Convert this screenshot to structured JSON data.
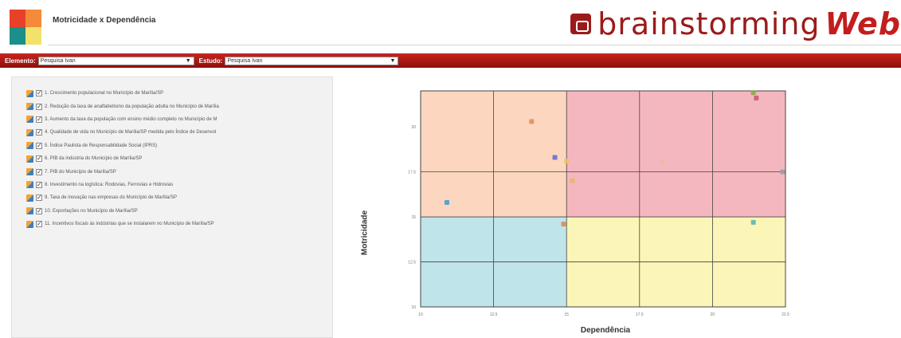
{
  "header": {
    "title": "Motricidade x Dependência",
    "brand_main": "brainstorming",
    "brand_accent": "Web"
  },
  "toolbar": {
    "element_label": "Elemento:",
    "element_value": "Pesquisa Ivan",
    "study_label": "Estudo:",
    "study_value": "Pesquisa Ivan"
  },
  "variables": [
    {
      "label": "1. Crescimento populacional no Município de Marília/SP",
      "checked": true
    },
    {
      "label": "2. Redução da taxa de analfabetismo da população adulta no Município de Marília",
      "checked": true
    },
    {
      "label": "3. Aumento da taxa da população com ensino médio completo no Município de M",
      "checked": true
    },
    {
      "label": "4. Qualidade de vida no Município de Marília/SP medida pelo Índice de Desenvol",
      "checked": true
    },
    {
      "label": "5. Índice Paulista de Responsabilidade Social (IPRS)",
      "checked": true
    },
    {
      "label": "6. PIB da indústria do Município de Marília/SP",
      "checked": true
    },
    {
      "label": "7. PIB do Município de Marília/SP",
      "checked": true
    },
    {
      "label": "8. Investimento na logística: Rodovias, Ferrovias e Hidrovias",
      "checked": true
    },
    {
      "label": "9. Taxa de inovação nas empresas do Município de Marília/SP",
      "checked": true
    },
    {
      "label": "10. Exportações no Município de Marília/SP",
      "checked": true
    },
    {
      "label": "11. Incentivos fiscais às indústrias que se instalarem no Município de Marília/SP",
      "checked": true
    }
  ],
  "chart_data": {
    "type": "scatter",
    "xlabel": "Dependência",
    "ylabel": "Motricidade",
    "xlim": [
      10,
      22.5
    ],
    "ylim": [
      10,
      22
    ],
    "x_ticks": [
      "10",
      "12.5",
      "15",
      "17.5",
      "20",
      "22.5"
    ],
    "y_ticks": [
      "10",
      "12.5",
      "15",
      "17.5",
      "20"
    ],
    "quadrant_colors": {
      "top_left": "#fcd6bf",
      "top_right": "#f5b7bf",
      "bottom_left": "#bfe4ea",
      "bottom_right": "#fbf5b8"
    },
    "points": [
      {
        "x": 10.9,
        "y": 15.8,
        "color": "#4a9bd1"
      },
      {
        "x": 13.8,
        "y": 20.3,
        "color": "#e0915a"
      },
      {
        "x": 14.6,
        "y": 18.3,
        "color": "#6a6fd0"
      },
      {
        "x": 15.0,
        "y": 18.1,
        "color": "#f2c06a"
      },
      {
        "x": 15.2,
        "y": 17.0,
        "color": "#f0b36a"
      },
      {
        "x": 14.9,
        "y": 14.6,
        "color": "#d98a5a"
      },
      {
        "x": 18.3,
        "y": 18.1,
        "color": "#f0b7a6"
      },
      {
        "x": 21.4,
        "y": 21.9,
        "color": "#8aa84a"
      },
      {
        "x": 21.5,
        "y": 21.6,
        "color": "#c95a78"
      },
      {
        "x": 22.4,
        "y": 17.5,
        "color": "#a89aa8"
      },
      {
        "x": 21.4,
        "y": 14.7,
        "color": "#5ab8b0"
      }
    ]
  }
}
